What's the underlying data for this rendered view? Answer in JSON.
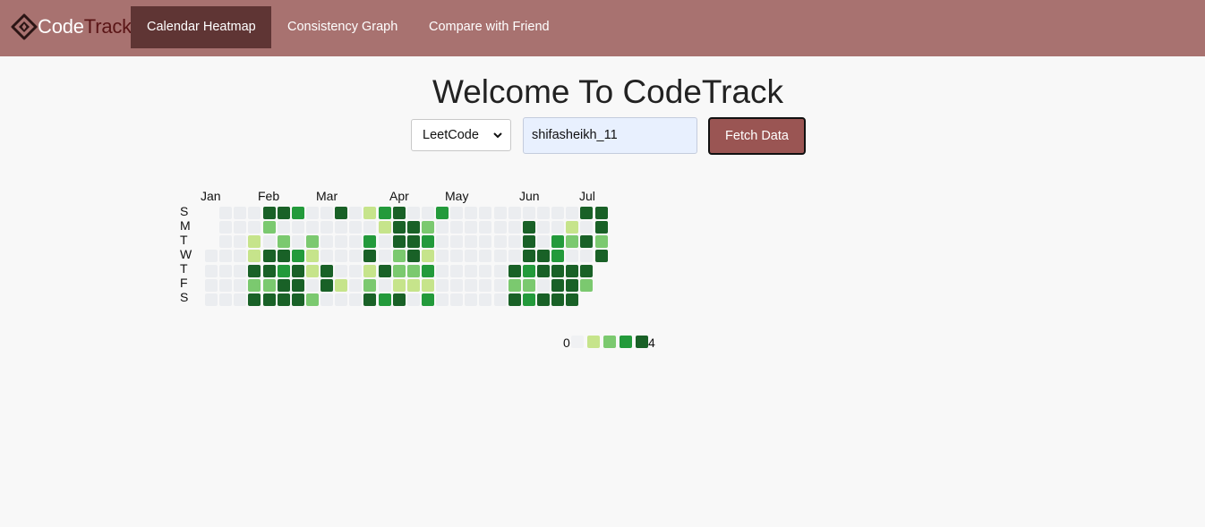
{
  "app": {
    "brand_part1": "Code",
    "brand_part2": "Track",
    "brand_icon": "diamond-code-icon"
  },
  "nav": {
    "items": [
      {
        "label": "Calendar Heatmap",
        "active": true
      },
      {
        "label": "Consistency Graph",
        "active": false
      },
      {
        "label": "Compare with Friend",
        "active": false
      }
    ]
  },
  "main": {
    "title": "Welcome To CodeTrack",
    "platform_select": {
      "selected": "LeetCode",
      "icon": "chevron-down-icon"
    },
    "username_input": {
      "value": "shifasheikh_11"
    },
    "fetch_label": "Fetch Data"
  },
  "heatmap": {
    "months": [
      "Jan",
      "Feb",
      "Mar",
      "Apr",
      "May",
      "Jun",
      "Jul"
    ],
    "days": [
      "S",
      "M",
      "T",
      "W",
      "T",
      "F",
      "S"
    ],
    "colors": [
      "#ebedf0",
      "#c6e48b",
      "#7bc96f",
      "#239a3b",
      "#196127"
    ],
    "legend_min": "0",
    "legend_max": "4",
    "weeks": [
      [
        null,
        null,
        null,
        0,
        0,
        0,
        0
      ],
      [
        0,
        0,
        0,
        0,
        0,
        0,
        0
      ],
      [
        0,
        0,
        0,
        0,
        0,
        0,
        0
      ],
      [
        0,
        0,
        1,
        1,
        4,
        2,
        4
      ],
      [
        4,
        2,
        0,
        4,
        4,
        2,
        4
      ],
      [
        4,
        0,
        2,
        4,
        3,
        4,
        4
      ],
      [
        3,
        0,
        0,
        3,
        4,
        4,
        4
      ],
      [
        0,
        0,
        2,
        1,
        1,
        0,
        2
      ],
      [
        0,
        0,
        0,
        0,
        4,
        4,
        0
      ],
      [
        4,
        0,
        0,
        0,
        0,
        1,
        0
      ],
      [
        0,
        0,
        0,
        0,
        0,
        0,
        0
      ],
      [
        1,
        0,
        3,
        4,
        1,
        2,
        4
      ],
      [
        3,
        1,
        0,
        0,
        4,
        0,
        3
      ],
      [
        4,
        4,
        4,
        2,
        2,
        1,
        4
      ],
      [
        0,
        4,
        4,
        4,
        2,
        1,
        0
      ],
      [
        0,
        2,
        3,
        1,
        3,
        1,
        3
      ],
      [
        3,
        0,
        0,
        0,
        0,
        0,
        0
      ],
      [
        0,
        0,
        0,
        0,
        0,
        0,
        0
      ],
      [
        0,
        0,
        0,
        0,
        0,
        0,
        0
      ],
      [
        0,
        0,
        0,
        0,
        0,
        0,
        0
      ],
      [
        0,
        0,
        0,
        0,
        0,
        0,
        0
      ],
      [
        0,
        0,
        0,
        0,
        4,
        2,
        4
      ],
      [
        0,
        4,
        4,
        4,
        3,
        2,
        3
      ],
      [
        0,
        0,
        0,
        4,
        4,
        0,
        4
      ],
      [
        0,
        0,
        3,
        3,
        4,
        4,
        4
      ],
      [
        0,
        1,
        2,
        0,
        4,
        4,
        4
      ],
      [
        4,
        0,
        4,
        0,
        4,
        2,
        null
      ],
      [
        4,
        4,
        2,
        4,
        null,
        null,
        null
      ]
    ]
  }
}
